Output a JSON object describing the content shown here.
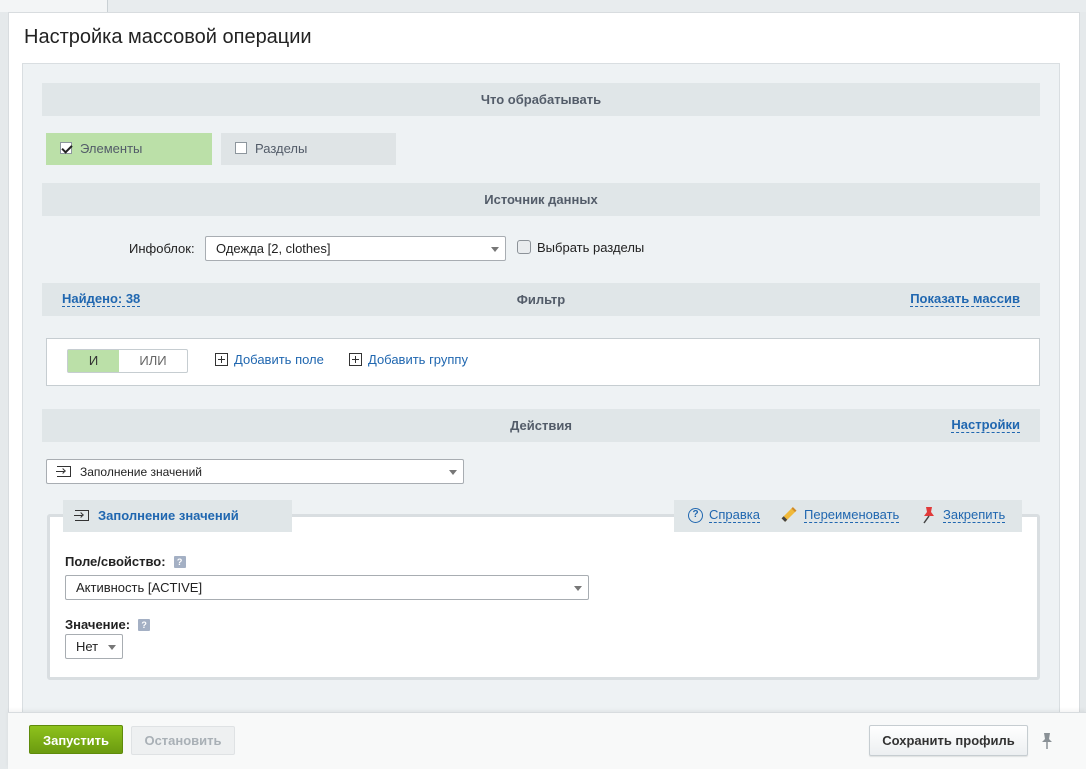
{
  "page": {
    "title": "Настройка массовой операции"
  },
  "process": {
    "header": "Что обрабатывать",
    "elements_label": "Элементы",
    "sections_label": "Разделы"
  },
  "source": {
    "header": "Источник данных",
    "iblock_label": "Инфоблок:",
    "iblock_value": "Одежда [2, clothes]",
    "select_sections_label": "Выбрать разделы"
  },
  "filter": {
    "found_label": "Найдено: 38",
    "header": "Фильтр",
    "show_array_label": "Показать массив",
    "and_label": "И",
    "or_label": "ИЛИ",
    "add_field_label": "Добавить поле",
    "add_group_label": "Добавить группу"
  },
  "actions": {
    "header": "Действия",
    "settings_label": "Настройки",
    "action_value": "Заполнение значений"
  },
  "action_block": {
    "title": "Заполнение значений",
    "help_label": "Справка",
    "rename_label": "Переименовать",
    "pin_label": "Закрепить",
    "field_label": "Поле/свойство:",
    "field_value": "Активность [ACTIVE]",
    "value_label": "Значение:",
    "value_value": "Нет"
  },
  "footer": {
    "run_label": "Запустить",
    "stop_label": "Остановить",
    "save_profile_label": "Сохранить профиль"
  },
  "colors": {
    "accent_green": "#bbe0a8",
    "link_blue": "#2067b0",
    "run_button": "#7aab14"
  }
}
